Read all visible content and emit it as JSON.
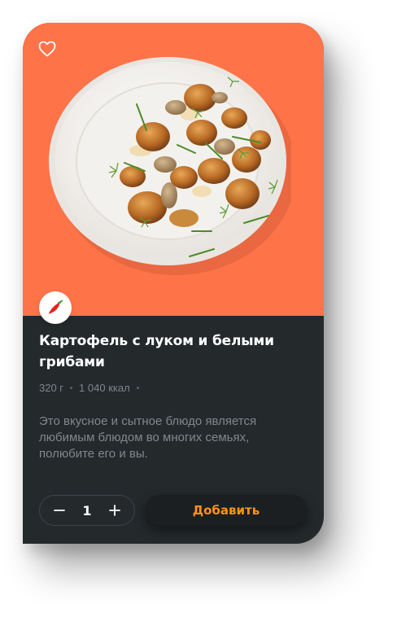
{
  "product": {
    "title": "Картофель с луком и белыми грибами",
    "weight": "320 г",
    "calories": "1 040 ккал",
    "description": "Это вкусное и сытное блюдо является любимым блюдом во многих семьях, полюбите его и вы."
  },
  "icons": {
    "favorite": "heart-outline-icon",
    "spicy": "chili-pepper-icon",
    "decrease": "minus-icon",
    "increase": "plus-icon"
  },
  "cart": {
    "quantity": "1",
    "add_label": "Добавить"
  },
  "colors": {
    "hero_background": "#ff7349",
    "card_background": "#24292c",
    "accent": "#ff9314"
  }
}
